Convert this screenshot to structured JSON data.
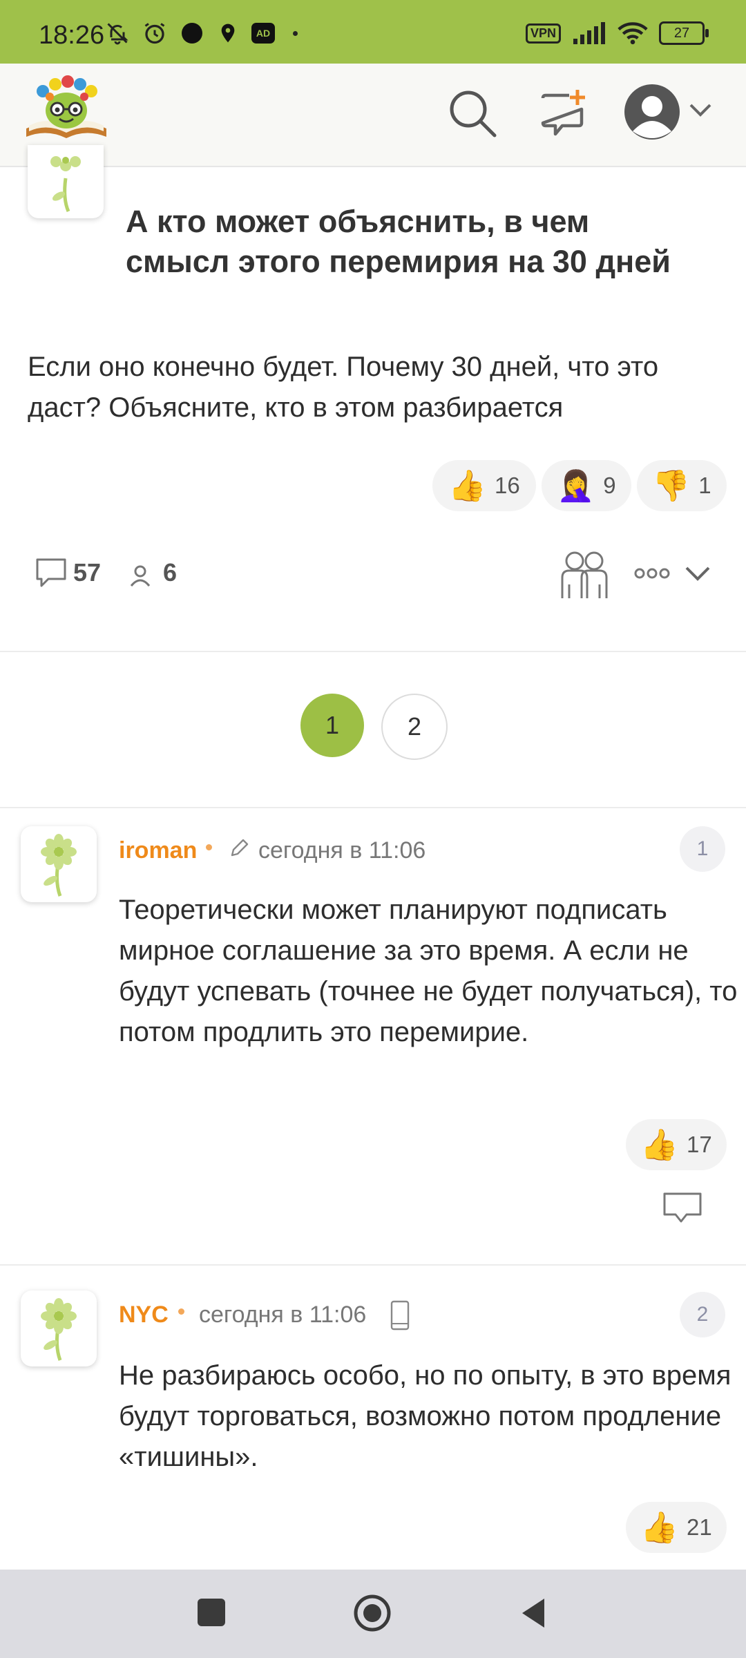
{
  "status_bar": {
    "time": "18:26",
    "ad_badge": "AD",
    "vpn": "VPN",
    "battery": "27"
  },
  "post": {
    "title": "А кто может объяснить, в чем смысл этого перемирия на 30 дней",
    "body": "Если оно конечно будет. Почему 30 дней, что это даст? Объясните, кто в этом разбирается",
    "reactions": {
      "like": "16",
      "facepalm": "9",
      "dislike": "1"
    },
    "comments_count": "57",
    "participants_count": "6"
  },
  "pagination": {
    "pages": [
      "1",
      "2"
    ],
    "current": "1"
  },
  "comments": [
    {
      "author": "iroman",
      "time": "сегодня в 11:06",
      "number": "1",
      "text": "Теоретически может планируют подписать мирное соглашение за это время. А если не будут успевать (точнее не будет получаться), то потом продлить это перемирие.",
      "likes": "17"
    },
    {
      "author": "NYC",
      "time": "сегодня в 11:06",
      "number": "2",
      "text": "Не разбираюсь особо, но по опыту, в это время будут торговаться, возможно потом продление «тишины».",
      "likes": "21"
    }
  ],
  "colors": {
    "status_bar": "#9fc14a",
    "accent_green": "#9dbf45",
    "author_orange": "#ef8a1a"
  }
}
